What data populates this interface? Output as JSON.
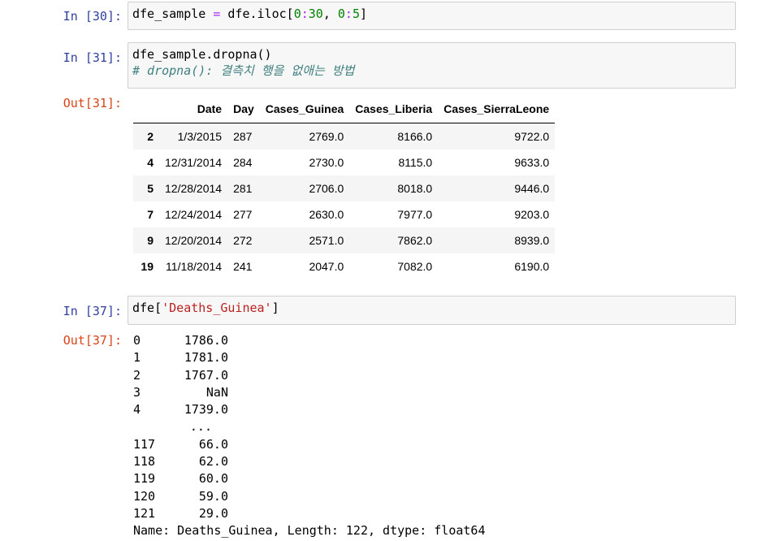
{
  "cells": {
    "c30": {
      "prompt": "In [30]:",
      "code": {
        "var": "dfe_sample",
        "op": "=",
        "pre": "dfe.iloc[",
        "n1": "0",
        "colon1": ":",
        "n2": "30",
        "sep": ", ",
        "n3": "0",
        "colon2": ":",
        "n4": "5",
        "post": "]"
      }
    },
    "c31": {
      "prompt": "In [31]:",
      "code_line": "dfe_sample.dropna()",
      "comment": "# dropna(): 결측치 행을 없애는 방법",
      "out_prompt": "Out[31]:"
    },
    "c37": {
      "prompt": "In [37]:",
      "code_pre": "dfe[",
      "code_str": "'Deaths_Guinea'",
      "code_post": "]",
      "out_prompt": "Out[37]:"
    }
  },
  "table": {
    "columns": [
      "",
      "Date",
      "Day",
      "Cases_Guinea",
      "Cases_Liberia",
      "Cases_SierraLeone"
    ],
    "rows": [
      {
        "index": "2",
        "cells": [
          "1/3/2015",
          "287",
          "2769.0",
          "8166.0",
          "9722.0"
        ]
      },
      {
        "index": "4",
        "cells": [
          "12/31/2014",
          "284",
          "2730.0",
          "8115.0",
          "9633.0"
        ]
      },
      {
        "index": "5",
        "cells": [
          "12/28/2014",
          "281",
          "2706.0",
          "8018.0",
          "9446.0"
        ]
      },
      {
        "index": "7",
        "cells": [
          "12/24/2014",
          "277",
          "2630.0",
          "7977.0",
          "9203.0"
        ]
      },
      {
        "index": "9",
        "cells": [
          "12/20/2014",
          "272",
          "2571.0",
          "7862.0",
          "8939.0"
        ]
      },
      {
        "index": "19",
        "cells": [
          "11/18/2014",
          "241",
          "2047.0",
          "7082.0",
          "6190.0"
        ]
      }
    ]
  },
  "series": {
    "head": [
      {
        "index": "0",
        "value": "1786.0"
      },
      {
        "index": "1",
        "value": "1781.0"
      },
      {
        "index": "2",
        "value": "1767.0"
      },
      {
        "index": "3",
        "value": "NaN"
      },
      {
        "index": "4",
        "value": "1739.0"
      }
    ],
    "ellipsis": "...",
    "tail": [
      {
        "index": "117",
        "value": "66.0"
      },
      {
        "index": "118",
        "value": "62.0"
      },
      {
        "index": "119",
        "value": "60.0"
      },
      {
        "index": "120",
        "value": "59.0"
      },
      {
        "index": "121",
        "value": "29.0"
      }
    ],
    "footer": "Name: Deaths_Guinea, Length: 122, dtype: float64"
  }
}
